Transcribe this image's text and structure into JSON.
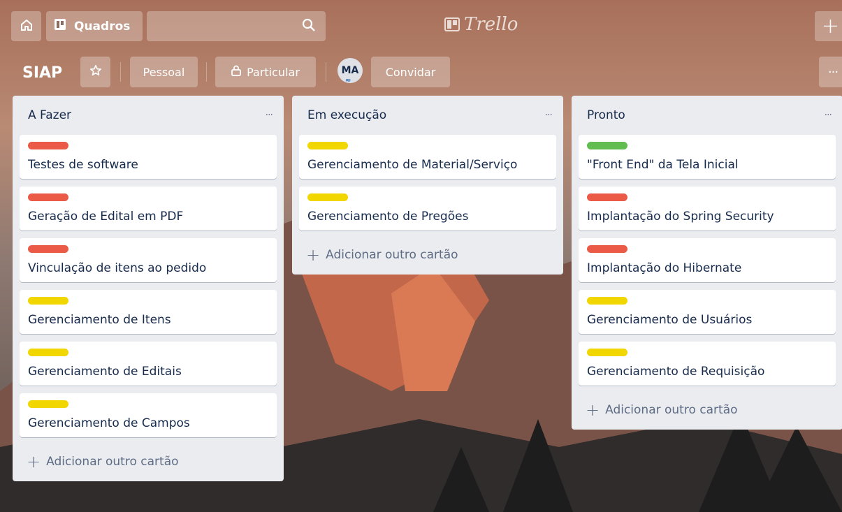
{
  "colors": {
    "red": "#eb5a46",
    "yellow": "#f2d600",
    "green": "#61bd4f"
  },
  "nav": {
    "home_icon": "home-icon",
    "boards_label": "Quadros",
    "search_icon": "search-icon",
    "logo_text": "Trello",
    "plus_label": "+"
  },
  "board": {
    "title": "SIAP",
    "star_icon": "star-icon",
    "team_label": "Pessoal",
    "visibility_label": "Particular",
    "member_initials": "MA",
    "invite_label": "Convidar",
    "more_label": "···"
  },
  "lists": [
    {
      "title": "A Fazer",
      "more": "···",
      "add_label": "Adicionar outro cartão",
      "cards": [
        {
          "label": "red",
          "text": "Testes de software"
        },
        {
          "label": "red",
          "text": "Geração de Edital em PDF"
        },
        {
          "label": "red",
          "text": "Vinculação de itens ao pedido"
        },
        {
          "label": "yellow",
          "text": "Gerenciamento de Itens"
        },
        {
          "label": "yellow",
          "text": "Gerenciamento de Editais"
        },
        {
          "label": "yellow",
          "text": "Gerenciamento de Campos"
        }
      ]
    },
    {
      "title": "Em execução",
      "more": "···",
      "add_label": "Adicionar outro cartão",
      "cards": [
        {
          "label": "yellow",
          "text": "Gerenciamento de Material/Serviço"
        },
        {
          "label": "yellow",
          "text": "Gerenciamento de Pregões"
        }
      ]
    },
    {
      "title": "Pronto",
      "more": "···",
      "add_label": "Adicionar outro cartão",
      "cards": [
        {
          "label": "green",
          "text": "\"Front End\" da Tela Inicial"
        },
        {
          "label": "red",
          "text": "Implantação do Spring Security"
        },
        {
          "label": "red",
          "text": "Implantação do Hibernate"
        },
        {
          "label": "yellow",
          "text": "Gerenciamento de Usuários"
        },
        {
          "label": "yellow",
          "text": "Gerenciamento de Requisição"
        }
      ]
    }
  ]
}
